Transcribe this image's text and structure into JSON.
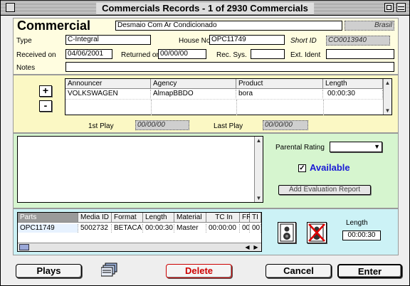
{
  "window": {
    "title": "Commercials Records - 1 of 2930 Commercials"
  },
  "header": {
    "heading": "Commercial",
    "title_value": "Desmaio Com Ar Condicionado",
    "country": "Brasil"
  },
  "fields": {
    "type_label": "Type",
    "type_value": "C-Integral",
    "house_no_label": "House No",
    "house_no_value": "OPC11749",
    "short_id_label": "Short ID",
    "short_id_value": "CO0013940",
    "received_on_label": "Received on",
    "received_on_value": "04/06/2001",
    "returned_on_label": "Returned on",
    "returned_on_value": "00/00/00",
    "rec_sys_label": "Rec. Sys.",
    "rec_sys_value": "",
    "ext_ident_label": "Ext. Ident",
    "ext_ident_value": "",
    "notes_label": "Notes",
    "notes_value": ""
  },
  "announcers_table": {
    "add_label": "+",
    "remove_label": "-",
    "columns": [
      "Announcer",
      "Agency",
      "Product",
      "Length"
    ],
    "rows": [
      [
        "VOLKSWAGEN",
        "AlmapBBDO",
        "bora",
        "00:00:30"
      ]
    ],
    "first_play_label": "1st Play",
    "first_play_value": "00/00/00",
    "last_play_label": "Last Play",
    "last_play_value": "00/00/00"
  },
  "evaluation": {
    "parental_rating_label": "Parental Rating",
    "parental_rating_value": "",
    "available_label": "Available",
    "available_checked": "✓",
    "add_report_label": "Add Evaluation Report"
  },
  "parts_table": {
    "columns": [
      "Parts",
      "Media ID",
      "Format",
      "Length",
      "Material",
      "TC In",
      "FR",
      "TI"
    ],
    "rows": [
      [
        "OPC11749",
        "5002732",
        "BETACAN",
        "00:00:30",
        "Master",
        "00:00:00",
        "00",
        "00"
      ]
    ],
    "length_label": "Length",
    "length_value": "00:00:30"
  },
  "footer": {
    "plays_label": "Plays",
    "delete_label": "Delete",
    "cancel_label": "Cancel",
    "enter_label": "Enter"
  },
  "colors": {
    "delete": "#cc0000",
    "available": "#1a1ad6"
  }
}
